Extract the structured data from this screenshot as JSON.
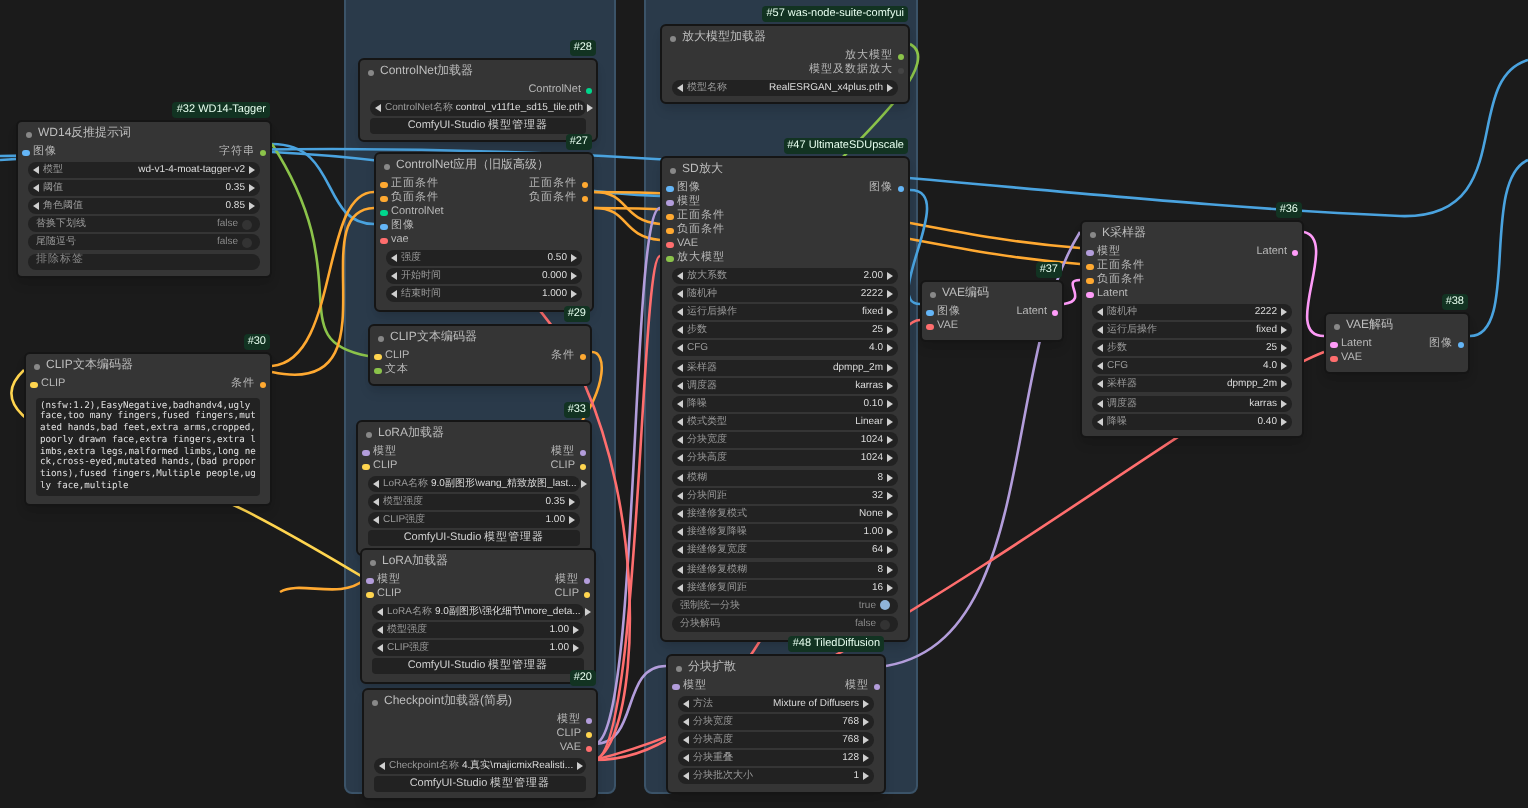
{
  "nodes": [
    {
      "title": "WD14反推提示词",
      "badge": "#32 WD14-Tagger",
      "inputs": [
        {
          "label": "图像",
          "color": "#64b5f6"
        }
      ],
      "outputs": [
        {
          "label": "字符串",
          "color": "#8bc34a"
        }
      ],
      "widgets": [
        {
          "kind": "combo",
          "label": "模型",
          "value": "wd-v1-4-moat-tagger-v2"
        },
        {
          "kind": "combo",
          "label": "阈值",
          "value": "0.35"
        },
        {
          "kind": "combo",
          "label": "角色阈值",
          "value": "0.85"
        },
        {
          "kind": "toggle",
          "label": "替换下划线",
          "value": "false",
          "on": false
        },
        {
          "kind": "toggle",
          "label": "尾随逗号",
          "value": "false",
          "on": false
        },
        {
          "kind": "field",
          "label": "排除标签"
        }
      ]
    },
    {
      "title": "CLIP文本编码器",
      "badge": "#30",
      "inputs": [
        {
          "label": "CLIP",
          "color": "#ffd54f"
        }
      ],
      "outputs": [
        {
          "label": "条件",
          "color": "#ffa931"
        }
      ],
      "widgets": [
        {
          "kind": "text",
          "value": "(nsfw:1.2),EasyNegative,badhandv4,ugly face,too many fingers,fused fingers,mutated hands,bad feet,extra arms,cropped,poorly drawn face,extra fingers,extra limbs,extra legs,malformed limbs,long neck,cross-eyed,mutated hands,(bad proportions),fused fingers,Multiple people,ugly face,multiple"
        }
      ]
    },
    {
      "title": "ControlNet加载器",
      "badge": "#28",
      "outputs": [
        {
          "label": "ControlNet",
          "color": "#00d78d"
        }
      ],
      "widgets": [
        {
          "kind": "combo",
          "label": "ControlNet名称",
          "value": "control_v11f1e_sd15_tile.pth"
        },
        {
          "kind": "button",
          "label": "ComfyUI-Studio 模型管理器"
        }
      ]
    },
    {
      "title": "ControlNet应用（旧版高级）",
      "badge": "#27",
      "inputs": [
        {
          "label": "正面条件",
          "color": "#ffa931"
        },
        {
          "label": "负面条件",
          "color": "#ffa931"
        },
        {
          "label": "ControlNet",
          "color": "#00d78d"
        },
        {
          "label": "图像",
          "color": "#64b5f6"
        },
        {
          "label": "vae",
          "color": "#ff6e6e"
        }
      ],
      "outputs": [
        {
          "label": "正面条件",
          "color": "#ffa931"
        },
        {
          "label": "负面条件",
          "color": "#ffa931"
        }
      ],
      "widgets": [
        {
          "kind": "combo",
          "label": "强度",
          "value": "0.50"
        },
        {
          "kind": "combo",
          "label": "开始时间",
          "value": "0.000"
        },
        {
          "kind": "combo",
          "label": "结束时间",
          "value": "1.000"
        }
      ]
    },
    {
      "title": "CLIP文本编码器",
      "badge": "#29",
      "inputs": [
        {
          "label": "CLIP",
          "color": "#ffd54f"
        },
        {
          "label": "文本",
          "color": "#8bc34a"
        }
      ],
      "outputs": [
        {
          "label": "条件",
          "color": "#ffa931"
        }
      ]
    },
    {
      "title": "LoRA加载器",
      "badge": "#33",
      "inputs": [
        {
          "label": "模型",
          "color": "#b39ddb"
        },
        {
          "label": "CLIP",
          "color": "#ffd54f"
        }
      ],
      "outputs": [
        {
          "label": "模型",
          "color": "#b39ddb"
        },
        {
          "label": "CLIP",
          "color": "#ffd54f"
        }
      ],
      "widgets": [
        {
          "kind": "combo",
          "label": "LoRA名称",
          "value": "9.0副图形\\wang_精致放图_last..."
        },
        {
          "kind": "combo",
          "label": "模型强度",
          "value": "0.35"
        },
        {
          "kind": "combo",
          "label": "CLIP强度",
          "value": "1.00"
        },
        {
          "kind": "button",
          "label": "ComfyUI-Studio 模型管理器"
        }
      ]
    },
    {
      "title": "LoRA加载器",
      "inputs": [
        {
          "label": "模型",
          "color": "#b39ddb"
        },
        {
          "label": "CLIP",
          "color": "#ffd54f"
        }
      ],
      "outputs": [
        {
          "label": "模型",
          "color": "#b39ddb"
        },
        {
          "label": "CLIP",
          "color": "#ffd54f"
        }
      ],
      "widgets": [
        {
          "kind": "combo",
          "label": "LoRA名称",
          "value": "9.0副图形\\强化细节\\more_deta..."
        },
        {
          "kind": "combo",
          "label": "模型强度",
          "value": "1.00"
        },
        {
          "kind": "combo",
          "label": "CLIP强度",
          "value": "1.00"
        },
        {
          "kind": "button",
          "label": "ComfyUI-Studio 模型管理器"
        }
      ]
    },
    {
      "title": "Checkpoint加载器(简易)",
      "badge": "#20",
      "outputs": [
        {
          "label": "模型",
          "color": "#b39ddb"
        },
        {
          "label": "CLIP",
          "color": "#ffd54f"
        },
        {
          "label": "VAE",
          "color": "#ff6e6e"
        }
      ],
      "widgets": [
        {
          "kind": "combo",
          "label": "Checkpoint名称",
          "value": "4.真实\\majicmixRealisti..."
        },
        {
          "kind": "button",
          "label": "ComfyUI-Studio 模型管理器"
        }
      ]
    },
    {
      "title": "放大模型加载器",
      "badge": "#57 was-node-suite-comfyui",
      "outputs": [
        {
          "label": "放大模型",
          "color": "#8bc34a"
        },
        {
          "label": "模型及数据放大",
          "color": "#444444"
        }
      ],
      "widgets": [
        {
          "kind": "combo",
          "label": "模型名称",
          "value": "RealESRGAN_x4plus.pth"
        }
      ]
    },
    {
      "title": "SD放大",
      "badge": "#47 UltimateSDUpscale",
      "inputs": [
        {
          "label": "图像",
          "color": "#64b5f6"
        },
        {
          "label": "模型",
          "color": "#b39ddb"
        },
        {
          "label": "正面条件",
          "color": "#ffa931"
        },
        {
          "label": "负面条件",
          "color": "#ffa931"
        },
        {
          "label": "VAE",
          "color": "#ff6e6e"
        },
        {
          "label": "放大模型",
          "color": "#8bc34a"
        }
      ],
      "outputs": [
        {
          "label": "图像",
          "color": "#64b5f6"
        }
      ],
      "widgets": [
        {
          "kind": "combo",
          "label": "放大系数",
          "value": "2.00"
        },
        {
          "kind": "combo",
          "label": "随机种",
          "value": "2222"
        },
        {
          "kind": "combo",
          "label": "运行后操作",
          "value": "fixed"
        },
        {
          "kind": "combo",
          "label": "步数",
          "value": "25"
        },
        {
          "kind": "combo",
          "label": "CFG",
          "value": "4.0"
        },
        {
          "kind": "combo",
          "label": "采样器",
          "value": "dpmpp_2m"
        },
        {
          "kind": "combo",
          "label": "调度器",
          "value": "karras"
        },
        {
          "kind": "combo",
          "label": "降噪",
          "value": "0.10"
        },
        {
          "kind": "combo",
          "label": "模式类型",
          "value": "Linear"
        },
        {
          "kind": "combo",
          "label": "分块宽度",
          "value": "1024"
        },
        {
          "kind": "combo",
          "label": "分块高度",
          "value": "1024"
        },
        {
          "kind": "combo",
          "label": "模糊",
          "value": "8"
        },
        {
          "kind": "combo",
          "label": "分块间距",
          "value": "32"
        },
        {
          "kind": "combo",
          "label": "接缝修复模式",
          "value": "None"
        },
        {
          "kind": "combo",
          "label": "接缝修复降噪",
          "value": "1.00"
        },
        {
          "kind": "combo",
          "label": "接缝修复宽度",
          "value": "64"
        },
        {
          "kind": "combo",
          "label": "接缝修复模糊",
          "value": "8"
        },
        {
          "kind": "combo",
          "label": "接缝修复间距",
          "value": "16"
        },
        {
          "kind": "toggle",
          "label": "强制统一分块",
          "value": "true",
          "on": true
        },
        {
          "kind": "toggle",
          "label": "分块解码",
          "value": "false",
          "on": false
        }
      ]
    },
    {
      "title": "分块扩散",
      "badge": "#48 TiledDiffusion",
      "inputs": [
        {
          "label": "模型",
          "color": "#b39ddb"
        }
      ],
      "outputs": [
        {
          "label": "模型",
          "color": "#b39ddb"
        }
      ],
      "widgets": [
        {
          "kind": "combo",
          "label": "方法",
          "value": "Mixture of Diffusers"
        },
        {
          "kind": "combo",
          "label": "分块宽度",
          "value": "768"
        },
        {
          "kind": "combo",
          "label": "分块高度",
          "value": "768"
        },
        {
          "kind": "combo",
          "label": "分块重叠",
          "value": "128"
        },
        {
          "kind": "combo",
          "label": "分块批次大小",
          "value": "1"
        }
      ]
    },
    {
      "title": "VAE编码",
      "badge": "#37",
      "inputs": [
        {
          "label": "图像",
          "color": "#64b5f6"
        },
        {
          "label": "VAE",
          "color": "#ff6e6e"
        }
      ],
      "outputs": [
        {
          "label": "Latent",
          "color": "#ff9cf9"
        }
      ]
    },
    {
      "title": "K采样器",
      "badge": "#36",
      "inputs": [
        {
          "label": "模型",
          "color": "#b39ddb"
        },
        {
          "label": "正面条件",
          "color": "#ffa931"
        },
        {
          "label": "负面条件",
          "color": "#ffa931"
        },
        {
          "label": "Latent",
          "color": "#ff9cf9"
        }
      ],
      "outputs": [
        {
          "label": "Latent",
          "color": "#ff9cf9"
        }
      ],
      "widgets": [
        {
          "kind": "combo",
          "label": "随机种",
          "value": "2222"
        },
        {
          "kind": "combo",
          "label": "运行后操作",
          "value": "fixed"
        },
        {
          "kind": "combo",
          "label": "步数",
          "value": "25"
        },
        {
          "kind": "combo",
          "label": "CFG",
          "value": "4.0"
        },
        {
          "kind": "combo",
          "label": "采样器",
          "value": "dpmpp_2m"
        },
        {
          "kind": "combo",
          "label": "调度器",
          "value": "karras"
        },
        {
          "kind": "combo",
          "label": "降噪",
          "value": "0.40"
        }
      ]
    },
    {
      "title": "VAE解码",
      "badge": "#38",
      "inputs": [
        {
          "label": "Latent",
          "color": "#ff9cf9"
        },
        {
          "label": "VAE",
          "color": "#ff6e6e"
        }
      ],
      "outputs": [
        {
          "label": "图像",
          "color": "#64b5f6"
        }
      ]
    }
  ]
}
